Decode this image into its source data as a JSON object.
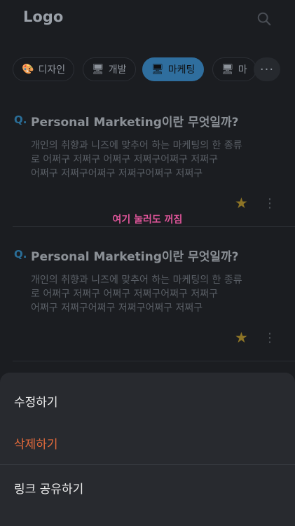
{
  "header": {
    "logo": "Logo",
    "search_icon": "search-icon"
  },
  "categories": [
    {
      "emoji": "🎨",
      "label": "디자인",
      "active": false
    },
    {
      "emoji": "🖥",
      "label": "개발",
      "active": false
    },
    {
      "emoji": "🖥",
      "label": "마케팅",
      "active": true
    },
    {
      "emoji": "🖥",
      "label": "마",
      "active": false
    }
  ],
  "more_label": "···",
  "cards": [
    {
      "q_label": "Q.",
      "title": "Personal Marketing이란 무엇일까?",
      "lines": [
        "개인의 취향과 니즈에 맞추어 하는 마케팅의 한 종류",
        "로 어쩌구 저쩌구 어쩌구 저쩌구어쩌구 저쩌구",
        "어쩌구 저쩌구어쩌구 저쩌구어쩌구 저쩌구"
      ],
      "starred": true
    },
    {
      "q_label": "Q.",
      "title": "Personal Marketing이란 무엇일까?",
      "lines": [
        "개인의 취향과 니즈에 맞추어 하는 마케팅의 한 종류",
        "로 어쩌구 저쩌구 어쩌구 저쩌구어쩌구 저쩌구",
        "어쩌구 저쩌구어쩌구 저쩌구어쩌구 저쩌구"
      ],
      "starred": true
    }
  ],
  "overlay_hint": "여기 눌러도 꺼짐",
  "sheet": {
    "edit_label": "수정하기",
    "delete_label": "삭제하기",
    "share_label": "링크 공유하기"
  },
  "colors": {
    "accent": "#2f6e9e",
    "danger": "#e36a3b",
    "hint": "#e0559a",
    "star": "#8d7426"
  }
}
